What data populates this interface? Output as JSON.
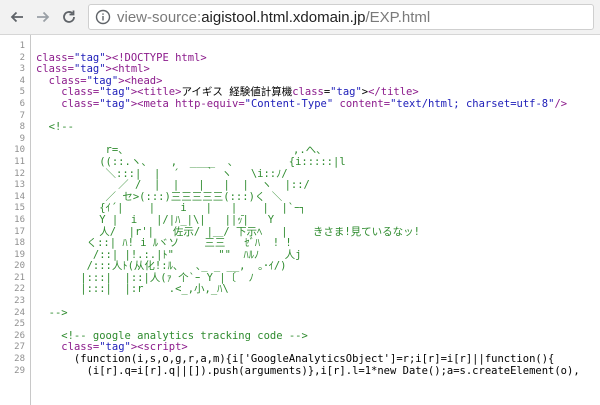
{
  "browser": {
    "url_scheme": "view-source:",
    "url_host": "aigistool.html.xdomain.jp",
    "url_path": "/EXP.html",
    "icons": {
      "back": "arrow-left-icon",
      "forward": "arrow-right-icon",
      "reload": "reload-icon",
      "info": "info-icon"
    }
  },
  "source": {
    "line_numbers": [
      "1",
      "2",
      "3",
      "4",
      "5",
      "6",
      "7",
      "8",
      "9",
      "10",
      "11",
      "12",
      "13",
      "14",
      "15",
      "16",
      "17",
      "18",
      "19",
      "20",
      "21",
      "22",
      "23",
      "24",
      "25",
      "26",
      "27",
      "28",
      "29"
    ],
    "lines": [
      "",
      "<!DOCTYPE html>",
      "<html>",
      "  <head>",
      "    <title>アイギス 経験値計算機</title>",
      "    <meta http-equiv=\"Content-Type\" content=\"text/html; charset=utf-8\"/>",
      "",
      "  <!--",
      "",
      "           r=、                          ,.へ、",
      "          ((::.ヽ、   ,  ____  、        {i:::::|l",
      "           ＼:::|  |  ´    ｀ ヽ   \\i::ﾉ/",
      "             ／ /  |  |   |   |  |  ヽ  |::/",
      "           ／ セ>(:::)三三三三三(:::)く ＼",
      "          {ｲ´|    |    i   |   |    |  |`ｰ┐",
      "          Y |  i   |/|ﾊ_|\\|   ||ｯ̄|   Y",
      "          人/  |r'|   佐示/ |＿/ 下示ﾍ   |    きさま!見ているなッ!",
      "        く::| ﾊ! i ﾙヾソ    三三   ｾﾞﾊ  ! !",
      "         /::| |!.:.|ﾄ\"       \"\"  ﾊﾙﾉ    人j",
      "        /:::人ﾄ(从化!:ﾙ、  ､_ _ __,  ｡･ｲ/)",
      "       |:::|  |::|人(ｧ 个`ｰ Y |〔  ﾉ",
      "       |:::|  |:r    .<_,小,_ﾊ\\",
      "",
      "  -->",
      "",
      "    <!-- google analytics tracking code -->",
      "    <script>",
      "      (function(i,s,o,g,r,a,m){i['GoogleAnalyticsObject']=r;i[r]=i[r]||function(){",
      "        (i[r].q=i[r].q||[]).push(arguments)},i[r].l=1*new Date();a=s.createElement(o),"
    ]
  }
}
